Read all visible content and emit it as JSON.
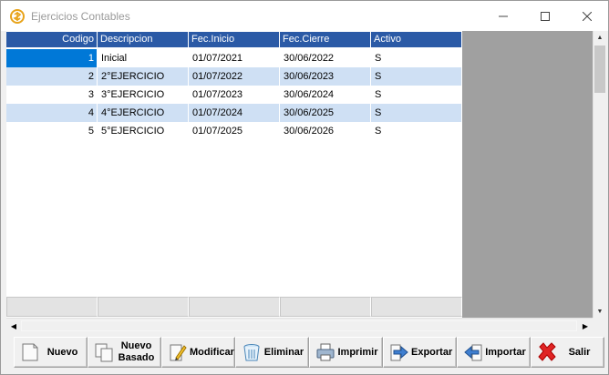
{
  "window": {
    "title": "Ejercicios Contables"
  },
  "grid": {
    "columns": [
      "Codigo",
      "Descripcion",
      "Fec.Inicio",
      "Fec.Cierre",
      "Activo"
    ],
    "rows": [
      [
        "1",
        "Inicial",
        "01/07/2021",
        "30/06/2022",
        "S"
      ],
      [
        "2",
        "2°EJERCICIO",
        "01/07/2022",
        "30/06/2023",
        "S"
      ],
      [
        "3",
        "3°EJERCICIO",
        "01/07/2023",
        "30/06/2024",
        "S"
      ],
      [
        "4",
        "4°EJERCICIO",
        "01/07/2024",
        "30/06/2025",
        "S"
      ],
      [
        "5",
        "5°EJERCICIO",
        "01/07/2025",
        "30/06/2026",
        "S"
      ]
    ],
    "selected_row": 0,
    "colors": {
      "header_bg": "#2b5aa6",
      "alt_row_bg": "#cfe0f4",
      "selection_bg": "#0078d7"
    }
  },
  "toolbar": {
    "buttons": [
      {
        "label": "Nuevo",
        "icon": "new-page-icon"
      },
      {
        "label": "Nuevo Basado",
        "icon": "copy-pages-icon"
      },
      {
        "label": "Modificar",
        "icon": "pencil-icon"
      },
      {
        "label": "Eliminar",
        "icon": "trash-icon"
      },
      {
        "label": "Imprimir",
        "icon": "printer-icon"
      },
      {
        "label": "Exportar",
        "icon": "export-arrow-icon"
      },
      {
        "label": "Importar",
        "icon": "import-arrow-icon"
      },
      {
        "label": "Salir",
        "icon": "exit-x-icon"
      }
    ]
  }
}
